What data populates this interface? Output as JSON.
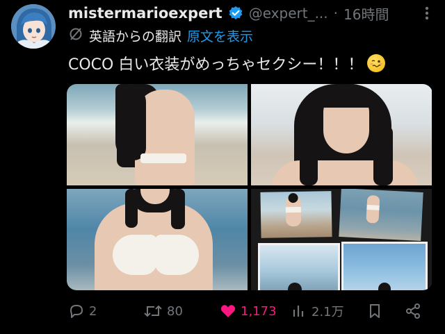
{
  "tweet": {
    "display_name": "mistermarioexpert",
    "handle": "@expert_...",
    "separator": "·",
    "time": "16時間",
    "translate_label": "英語からの翻訳",
    "translate_link": "原文を表示",
    "text": "COCO 白い衣装がめっちゃセクシー！！！",
    "emoji": "woozy-face-emoji"
  },
  "media": {
    "images": [
      "photo-1",
      "photo-2",
      "photo-3",
      "photo-4"
    ]
  },
  "actions": {
    "reply_count": "2",
    "repost_count": "80",
    "like_count": "1,173",
    "view_count": "2.1万"
  },
  "colors": {
    "background": "#000000",
    "text": "#e7e9ea",
    "muted": "#71767b",
    "link": "#1d9bf0",
    "like": "#f91880",
    "verified": "#1d9bf0"
  }
}
